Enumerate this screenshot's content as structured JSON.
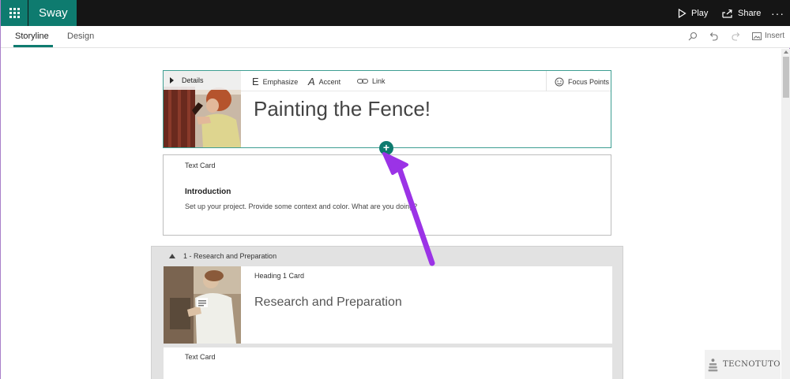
{
  "app": {
    "name": "Sway"
  },
  "topbar": {
    "play_label": "Play",
    "share_label": "Share",
    "more_label": "···"
  },
  "nav": {
    "tabs": [
      {
        "label": "Storyline"
      },
      {
        "label": "Design"
      }
    ],
    "insert_label": "Insert"
  },
  "title_card": {
    "details_label": "Details",
    "toolbar": {
      "emphasize": "Emphasize",
      "accent": "Accent",
      "link": "Link",
      "focus_points": "Focus Points",
      "emphasize_glyph": "E",
      "accent_glyph": "A"
    },
    "title": "Painting the Fence!"
  },
  "add_button": {
    "glyph": "+"
  },
  "text_card": {
    "label": "Text Card",
    "heading": "Introduction",
    "body": "Set up your project. Provide some context and color.  What are you doing?"
  },
  "section": {
    "label": "1 - Research and Preparation",
    "heading_card": {
      "label": "Heading 1 Card",
      "title": "Research and Preparation"
    },
    "text_card": {
      "label": "Text Card"
    }
  },
  "watermark": {
    "text": "TECNOTUTO"
  },
  "colors": {
    "accent": "#0e7b6f",
    "annotation_arrow": "#9b33e6",
    "topbar": "#151515"
  }
}
